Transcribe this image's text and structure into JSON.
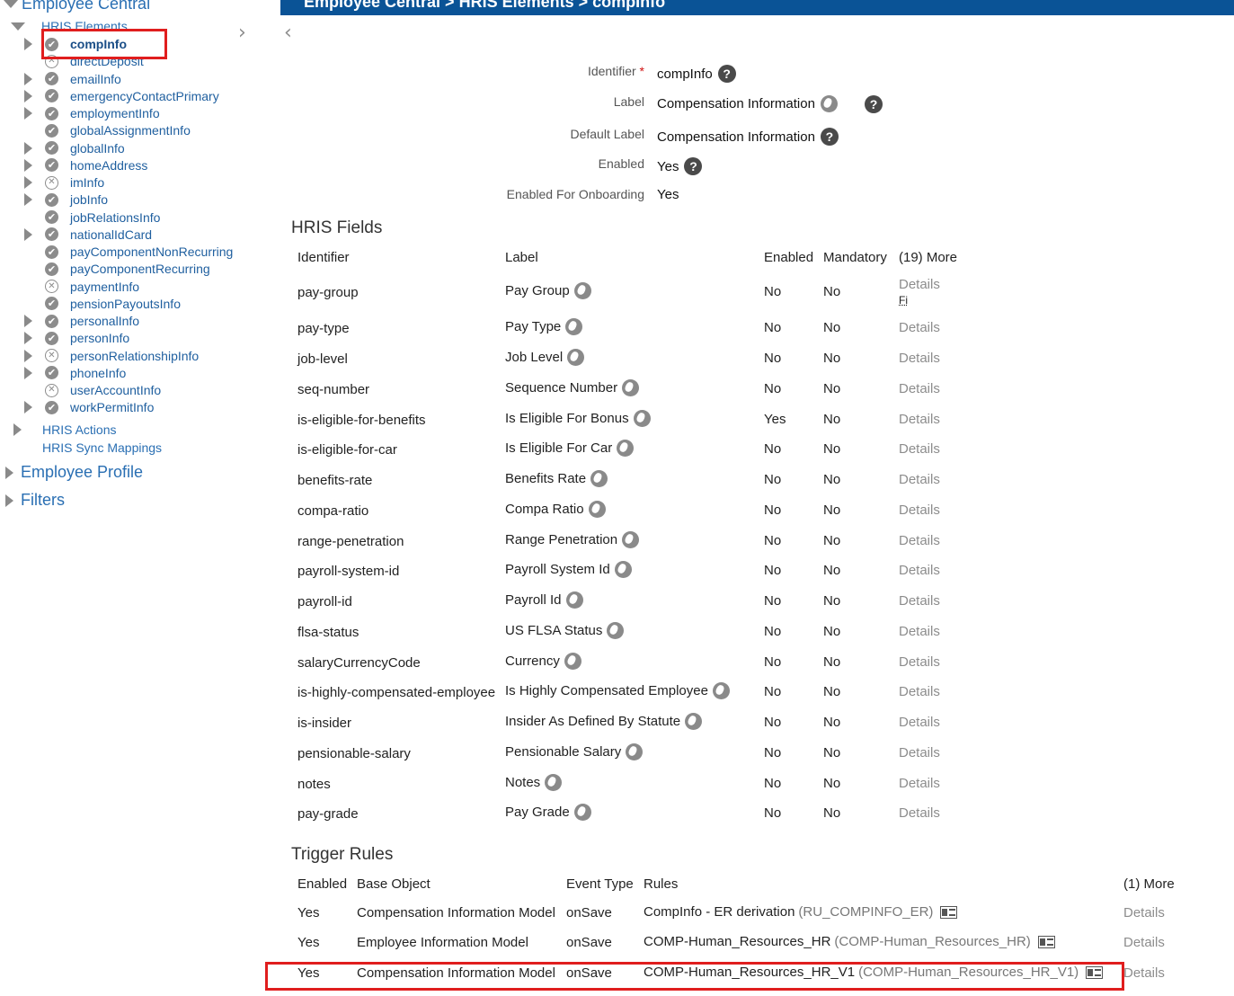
{
  "header": {
    "title": "Employee Central > HRIS Elements > compInfo"
  },
  "sidebar": {
    "employee_central": "Employee Central",
    "hris_elements": "HRIS Elements",
    "items": [
      {
        "label": "compInfo",
        "status": "check",
        "expandable": true,
        "selected": true
      },
      {
        "label": "directDeposit",
        "status": "x",
        "expandable": false
      },
      {
        "label": "emailInfo",
        "status": "check",
        "expandable": true
      },
      {
        "label": "emergencyContactPrimary",
        "status": "check",
        "expandable": true
      },
      {
        "label": "employmentInfo",
        "status": "check",
        "expandable": true
      },
      {
        "label": "globalAssignmentInfo",
        "status": "check",
        "expandable": false
      },
      {
        "label": "globalInfo",
        "status": "check",
        "expandable": true
      },
      {
        "label": "homeAddress",
        "status": "check",
        "expandable": true
      },
      {
        "label": "imInfo",
        "status": "x",
        "expandable": true
      },
      {
        "label": "jobInfo",
        "status": "check",
        "expandable": true
      },
      {
        "label": "jobRelationsInfo",
        "status": "check",
        "expandable": false
      },
      {
        "label": "nationalIdCard",
        "status": "check",
        "expandable": true
      },
      {
        "label": "payComponentNonRecurring",
        "status": "check",
        "expandable": false
      },
      {
        "label": "payComponentRecurring",
        "status": "check",
        "expandable": false
      },
      {
        "label": "paymentInfo",
        "status": "x",
        "expandable": false
      },
      {
        "label": "pensionPayoutsInfo",
        "status": "check",
        "expandable": false
      },
      {
        "label": "personalInfo",
        "status": "check",
        "expandable": true
      },
      {
        "label": "personInfo",
        "status": "check",
        "expandable": true
      },
      {
        "label": "personRelationshipInfo",
        "status": "x",
        "expandable": true
      },
      {
        "label": "phoneInfo",
        "status": "check",
        "expandable": true
      },
      {
        "label": "userAccountInfo",
        "status": "x",
        "expandable": false
      },
      {
        "label": "workPermitInfo",
        "status": "check",
        "expandable": true
      }
    ],
    "hris_actions": "HRIS Actions",
    "hris_sync": "HRIS Sync Mappings",
    "employee_profile": "Employee Profile",
    "filters": "Filters"
  },
  "properties": {
    "identifier_label": "Identifier",
    "required_mark": "*",
    "identifier_value": "compInfo",
    "label_label": "Label",
    "label_value": "Compensation Information",
    "default_label_label": "Default Label",
    "default_label_value": "Compensation Information",
    "enabled_label": "Enabled",
    "enabled_value": "Yes",
    "onboarding_label": "Enabled For Onboarding",
    "onboarding_value": "Yes",
    "help_glyph": "?"
  },
  "hris_fields": {
    "title": "HRIS Fields",
    "columns": {
      "identifier": "Identifier",
      "label": "Label",
      "enabled": "Enabled",
      "mandatory": "Mandatory",
      "more": "(19) More"
    },
    "details_label": "Details",
    "first_row_extra": "Fi",
    "rows": [
      {
        "id": "pay-group",
        "label": "Pay Group",
        "enabled": "No",
        "mandatory": "No"
      },
      {
        "id": "pay-type",
        "label": "Pay Type",
        "enabled": "No",
        "mandatory": "No"
      },
      {
        "id": "job-level",
        "label": "Job Level",
        "enabled": "No",
        "mandatory": "No"
      },
      {
        "id": "seq-number",
        "label": "Sequence Number",
        "enabled": "No",
        "mandatory": "No"
      },
      {
        "id": "is-eligible-for-benefits",
        "label": "Is Eligible For Bonus",
        "enabled": "Yes",
        "mandatory": "No"
      },
      {
        "id": "is-eligible-for-car",
        "label": "Is Eligible For Car",
        "enabled": "No",
        "mandatory": "No"
      },
      {
        "id": "benefits-rate",
        "label": "Benefits Rate",
        "enabled": "No",
        "mandatory": "No"
      },
      {
        "id": "compa-ratio",
        "label": "Compa Ratio",
        "enabled": "No",
        "mandatory": "No"
      },
      {
        "id": "range-penetration",
        "label": "Range Penetration",
        "enabled": "No",
        "mandatory": "No"
      },
      {
        "id": "payroll-system-id",
        "label": "Payroll System Id",
        "enabled": "No",
        "mandatory": "No"
      },
      {
        "id": "payroll-id",
        "label": "Payroll Id",
        "enabled": "No",
        "mandatory": "No"
      },
      {
        "id": "flsa-status",
        "label": "US FLSA Status",
        "enabled": "No",
        "mandatory": "No"
      },
      {
        "id": "salaryCurrencyCode",
        "label": "Currency",
        "enabled": "No",
        "mandatory": "No"
      },
      {
        "id": "is-highly-compensated-employee",
        "label": "Is Highly Compensated Employee",
        "enabled": "No",
        "mandatory": "No"
      },
      {
        "id": "is-insider",
        "label": "Insider As Defined By Statute",
        "enabled": "No",
        "mandatory": "No"
      },
      {
        "id": "pensionable-salary",
        "label": "Pensionable Salary",
        "enabled": "No",
        "mandatory": "No"
      },
      {
        "id": "notes",
        "label": "Notes",
        "enabled": "No",
        "mandatory": "No"
      },
      {
        "id": "pay-grade",
        "label": "Pay Grade",
        "enabled": "No",
        "mandatory": "No"
      }
    ]
  },
  "trigger_rules": {
    "title": "Trigger Rules",
    "columns": {
      "enabled": "Enabled",
      "base_object": "Base Object",
      "event_type": "Event Type",
      "rules": "Rules",
      "more": "(1) More"
    },
    "details_label": "Details",
    "rows": [
      {
        "enabled": "Yes",
        "base_object": "Compensation Information Model",
        "event": "onSave",
        "rule_name": "CompInfo - ER derivation",
        "rule_id": "(RU_COMPINFO_ER)"
      },
      {
        "enabled": "Yes",
        "base_object": "Employee Information Model",
        "event": "onSave",
        "rule_name": "COMP-Human_Resources_HR",
        "rule_id": "(COMP-Human_Resources_HR)"
      },
      {
        "enabled": "Yes",
        "base_object": "Compensation Information Model",
        "event": "onSave",
        "rule_name": "COMP-Human_Resources_HR_V1",
        "rule_id": "(COMP-Human_Resources_HR_V1)"
      }
    ]
  },
  "colors": {
    "header_bg": "#0a5396",
    "link": "#1f5f9f",
    "highlight": "#e01e1e"
  }
}
